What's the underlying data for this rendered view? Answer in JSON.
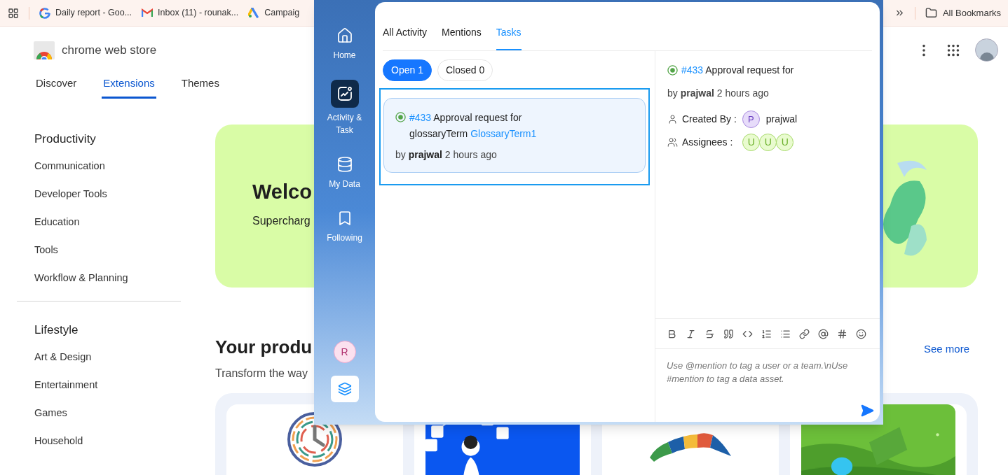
{
  "bookmarks_bar": {
    "items": [
      {
        "label": "Daily report - Goo..."
      },
      {
        "label": "Inbox (11) - rounak..."
      },
      {
        "label": "Campaig"
      }
    ],
    "all_bookmarks": "All Bookmarks"
  },
  "store": {
    "title": "chrome web store",
    "nav": [
      {
        "label": "Discover",
        "selected": false
      },
      {
        "label": "Extensions",
        "selected": true
      },
      {
        "label": "Themes",
        "selected": false
      }
    ],
    "categories": [
      {
        "heading": "Productivity",
        "items": [
          "Communication",
          "Developer Tools",
          "Education",
          "Tools",
          "Workflow & Planning"
        ]
      },
      {
        "heading": "Lifestyle",
        "items": [
          "Art & Design",
          "Entertainment",
          "Games",
          "Household"
        ]
      }
    ],
    "banner": {
      "title": "Welco",
      "subtitle": "Supercharg"
    },
    "section": {
      "title": "Your produ",
      "subtitle": "Transform the way",
      "see_more": "See more"
    },
    "cards": [
      {
        "kind": "clock"
      },
      {
        "kind": "picture"
      },
      {
        "kind": "boomerang"
      },
      {
        "kind": "picture"
      }
    ]
  },
  "panel": {
    "nav": [
      {
        "label": "Home",
        "selected": false
      },
      {
        "label": "Activity & Task",
        "selected": true
      },
      {
        "label": "My Data",
        "selected": false
      },
      {
        "label": "Following",
        "selected": false
      }
    ],
    "user_avatar": "R",
    "tabs": [
      {
        "label": "All Activity",
        "selected": false
      },
      {
        "label": "Mentions",
        "selected": false
      },
      {
        "label": "Tasks",
        "selected": true
      }
    ],
    "filters": [
      {
        "label": "Open 1",
        "selected": true
      },
      {
        "label": "Closed 0",
        "selected": false
      }
    ],
    "tasks": [
      {
        "number": "#433",
        "title": "Approval request for",
        "entity_type": "glossaryTerm",
        "entity_link": "GlossaryTerm1",
        "byline": "by **prajwal** 2 hours ago",
        "selected": true
      }
    ],
    "detail": {
      "number": "#433",
      "title": "Approval request for",
      "byline": "by **prajwal** 2 hours ago",
      "created_by_label": "Created By :",
      "creator_initial": "P",
      "creator": "prajwal",
      "assignees_label": "Assignees :",
      "assignees": [
        "U",
        "U",
        "U"
      ]
    },
    "editor": {
      "placeholder": "Use @mention to tag a user or a team.\\nUse #mention to tag a data asset."
    }
  }
}
